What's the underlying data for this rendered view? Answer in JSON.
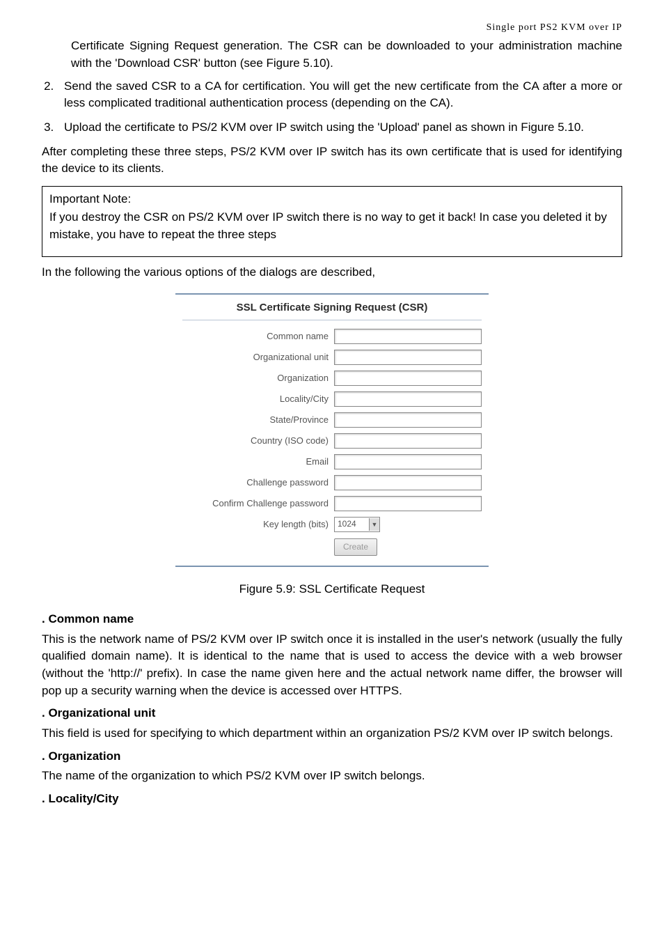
{
  "header": {
    "doc_title": "Single port PS2 KVM over IP"
  },
  "intro_cont": "Certificate Signing Request generation. The CSR can be downloaded to your administration machine with the 'Download CSR' button (see Figure 5.10).",
  "steps": {
    "s2": "Send the saved CSR to a CA for certification. You will get the new certificate from the CA after a more or less complicated traditional authentication process (depending on the CA).",
    "s3": "Upload the certificate to PS/2 KVM over IP switch using the 'Upload' panel as shown in Figure 5.10."
  },
  "after_steps": "After completing these three steps, PS/2 KVM over IP switch has its own certificate that is used for identifying the device to its clients.",
  "note": {
    "title": "Important Note:",
    "body": "If you destroy the CSR on PS/2 KVM over IP switch there is no way to get it back! In case you deleted it by mistake, you have to repeat the three steps"
  },
  "dialog_intro": "In the following the various options of the dialogs are described,",
  "form": {
    "title": "SSL Certificate Signing Request (CSR)",
    "fields": {
      "common_name": "Common name",
      "org_unit": "Organizational unit",
      "organization": "Organization",
      "locality": "Locality/City",
      "state": "State/Province",
      "country": "Country (ISO code)",
      "email": "Email",
      "challenge_pw": "Challenge password",
      "confirm_pw": "Confirm Challenge password",
      "key_length": "Key length (bits)"
    },
    "key_length_value": "1024",
    "create_btn": "Create"
  },
  "figure_caption": "Figure 5.9: SSL Certificate Request",
  "definitions": {
    "common_name": {
      "term": ". Common name",
      "desc": "This is the network name of PS/2 KVM over IP switch once it is installed in the user's network (usually the fully qualified domain name). It is identical to the name that is used to access the device with a web browser (without the 'http://' prefix). In case the name given here and the actual network name differ, the browser will pop up a security warning when the device is accessed over HTTPS."
    },
    "org_unit": {
      "term": ". Organizational unit",
      "desc": "This field is used for specifying to which department within an organization PS/2 KVM over IP switch belongs."
    },
    "organization": {
      "term": ". Organization",
      "desc": "The name of the organization to which PS/2 KVM over IP switch belongs."
    },
    "locality": {
      "term": ". Locality/City"
    }
  }
}
